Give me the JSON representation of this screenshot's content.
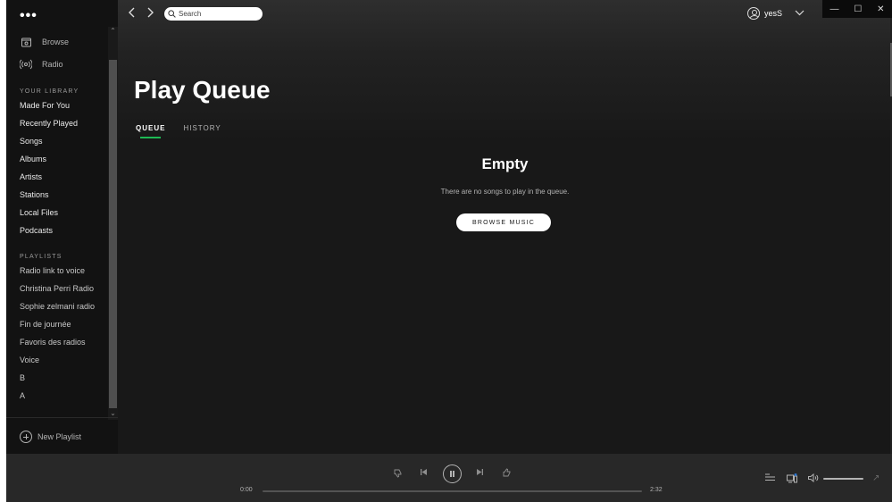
{
  "sidebar": {
    "menu_glyph": "•••",
    "nav": [
      {
        "label": "Browse",
        "icon": "browse-icon"
      },
      {
        "label": "Radio",
        "icon": "radio-icon"
      }
    ],
    "library_title": "YOUR LIBRARY",
    "library": [
      "Made For You",
      "Recently Played",
      "Songs",
      "Albums",
      "Artists",
      "Stations",
      "Local Files",
      "Podcasts"
    ],
    "playlists_title": "PLAYLISTS",
    "playlists": [
      "Radio link to voice",
      "Christina Perri Radio",
      "Sophie zelmani radio",
      "Fin de journée",
      "Favoris des radios",
      "Voice",
      "B",
      "A"
    ],
    "new_playlist": "New Playlist"
  },
  "topbar": {
    "search_placeholder": "Search",
    "username": "yesS"
  },
  "main": {
    "title": "Play Queue",
    "tabs": [
      "QUEUE",
      "HISTORY"
    ],
    "active_tab": "QUEUE",
    "empty_title": "Empty",
    "empty_text": "There are no songs to play in the queue.",
    "browse_button": "BROWSE MUSIC"
  },
  "player": {
    "elapsed": "0:00",
    "duration": "2:32",
    "progress": 0
  },
  "colors": {
    "accent": "#1db954",
    "background": "#181818",
    "sidebar": "#121212",
    "player": "#282828"
  }
}
